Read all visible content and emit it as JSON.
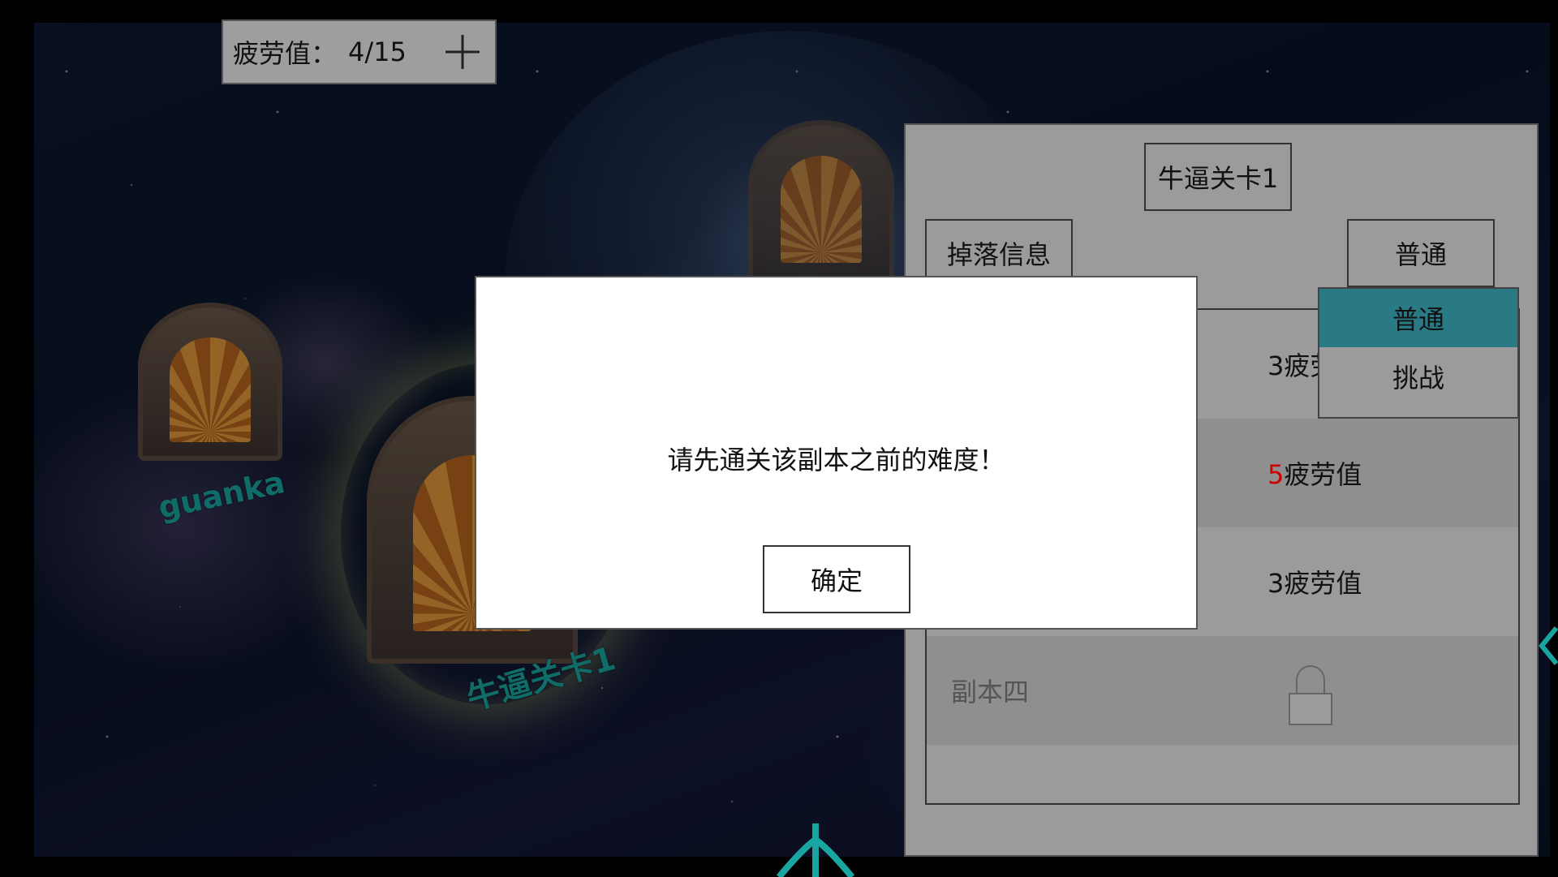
{
  "fatigue": {
    "label": "疲劳值：",
    "value": "4/15",
    "plus_icon": "plus-icon"
  },
  "portals": [
    {
      "label": "guanka"
    },
    {
      "label": "牛逼关卡1"
    }
  ],
  "panel": {
    "title": "牛逼关卡1",
    "drop_info_label": "掉落信息",
    "difficulty_selected": "普通",
    "difficulty_options": [
      "普通",
      "挑战"
    ],
    "rows": [
      {
        "name": "",
        "cost_num": "3",
        "cost_unit": "疲劳值"
      },
      {
        "name": "",
        "cost_num": "5",
        "cost_unit": "疲劳值",
        "cost_num_color": "#cc0000"
      },
      {
        "name": "",
        "cost_num": "3",
        "cost_unit": "疲劳值"
      },
      {
        "name": "副本四",
        "locked": true,
        "lock_icon": "lock-icon"
      }
    ]
  },
  "modal": {
    "message": "请先通关该副本之前的难度！",
    "ok_label": "确定"
  },
  "colors": {
    "accent": "#2a7a86",
    "portal_label": "#1aa6a0",
    "panel_bg": "#9b9b9b"
  }
}
